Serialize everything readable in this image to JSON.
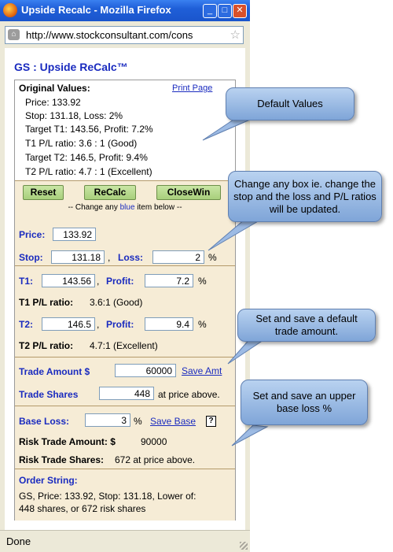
{
  "window": {
    "title": "Upside Recalc - Mozilla Firefox",
    "url": "http://www.stockconsultant.com/cons",
    "status": "Done",
    "buttons": {
      "minimize": "_",
      "maximize": "□",
      "close": "✕"
    }
  },
  "page": {
    "title": "GS : Upside ReCalc™",
    "original": {
      "heading": "Original Values:",
      "print_link": "Print Page",
      "lines": [
        "Price: 133.92",
        "Stop: 131.18,   Loss: 2%",
        "Target T1: 143.56,   Profit: 7.2%",
        "T1 P/L ratio: 3.6 : 1  (Good)",
        "Target T2: 146.5,   Profit: 9.4%",
        "T2 P/L ratio: 4.7 : 1  (Excellent)"
      ]
    },
    "buttons": {
      "reset": "Reset",
      "recalc": "ReCalc",
      "closewin": "CloseWin"
    },
    "hint": {
      "before": "-- Change any ",
      "blue": "blue",
      "after": " item below --"
    },
    "price": {
      "label": "Price:",
      "value": "133.92"
    },
    "stop": {
      "label": "Stop:",
      "value": "131.18",
      "suffix": ","
    },
    "loss": {
      "label": "Loss:",
      "value": "2",
      "suffix": "%"
    },
    "t1": {
      "label": "T1:",
      "value": "143.56",
      "suffix": ","
    },
    "profit1": {
      "label": "Profit:",
      "value": "7.2",
      "suffix": "%"
    },
    "t1_ratio": {
      "label": "T1 P/L ratio:",
      "value": "3.6:1  (Good)"
    },
    "t2": {
      "label": "T2:",
      "value": "146.5",
      "suffix": ","
    },
    "profit2": {
      "label": "Profit:",
      "value": "9.4",
      "suffix": "%"
    },
    "t2_ratio": {
      "label": "T2 P/L ratio:",
      "value": "4.7:1  (Excellent)"
    },
    "trade_amount": {
      "label": "Trade Amount $",
      "value": "60000",
      "link": "Save Amt"
    },
    "trade_shares": {
      "label": "Trade Shares",
      "value": "448",
      "suffix": "at price above."
    },
    "base_loss": {
      "label": "Base Loss:",
      "value": "3",
      "suffix": "%",
      "link": "Save Base",
      "help": "?"
    },
    "risk_amount": {
      "label": "Risk Trade Amount: $",
      "value": "90000"
    },
    "risk_shares": {
      "label": "Risk Trade Shares:",
      "value": "672 at price above."
    },
    "order": {
      "label": "Order String:",
      "line1": "GS, Price: 133.92, Stop: 131.18, Lower of:",
      "line2": "448 shares, or 672 risk shares"
    }
  },
  "callouts": {
    "default_values": "Default Values",
    "change_box": "Change any box ie. change the stop and the loss and P/L ratios will be updated.",
    "trade_amount": "Set and save a default trade amount.",
    "base_loss": "Set and save an upper base loss %"
  },
  "colors": {
    "link_blue": "#1a2bbf",
    "tan": "#f6ecd6",
    "button_green": "#a8cf7c",
    "callout_blue": "#7fa5d8"
  }
}
